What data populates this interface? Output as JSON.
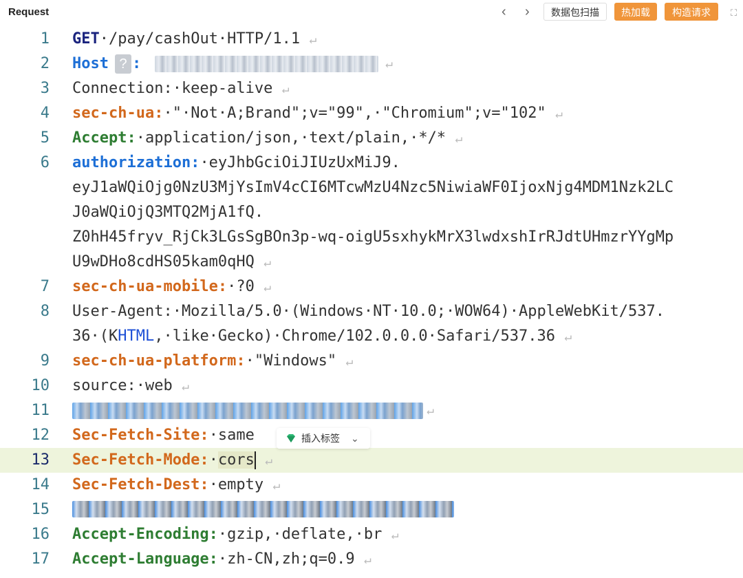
{
  "header": {
    "title": "Request",
    "nav_prev": "‹",
    "nav_next": "›",
    "btn_scan": "数据包扫描",
    "btn_hot": "热加载",
    "btn_build": "构造请求",
    "expand_glyph": "⛶"
  },
  "colors": {
    "accent_orange": "#f0953a",
    "key_blue": "#1d6fd6",
    "key_orange": "#d2681c",
    "key_green": "#2e7d32",
    "highlight_line": "#eef4dc"
  },
  "lines": [
    {
      "n": "1",
      "verb": "GET",
      "rest": "·/pay/cashOut·HTTP/1.1"
    },
    {
      "n": "2",
      "key": "Host",
      "sep": ":"
    },
    {
      "n": "3",
      "text": "Connection:·keep-alive"
    },
    {
      "n": "4",
      "key": "sec-ch-ua:",
      "value": "·\"·Not·A;Brand\";v=\"99\",·\"Chromium\";v=\"102\""
    },
    {
      "n": "5",
      "key": "Accept:",
      "value": "·application/json,·text/plain,·*/*"
    },
    {
      "n": "6",
      "key": "authorization:",
      "value": "·eyJhbGciOiJIUzUxMiJ9.",
      "wrap": [
        "eyJ1aWQiOjg0NzU3MjYsImV4cCI6MTcwMzU4Nzc5NiwiaWF0IjoxNjg4MDM1Nzk2LC",
        "J0aWQiOjQ3MTQ2MjA1fQ.",
        "Z0hH45fryv_RjCk3LGsSgBOn3p-wq-oigU5sxhykMrX3lwdxshIrRJdtUHmzrYYgMp",
        "U9wDHo8cdHS05kam0qHQ"
      ]
    },
    {
      "n": "7",
      "key": "sec-ch-ua-mobile:",
      "value": "·?0"
    },
    {
      "n": "8",
      "text": "User-Agent:·Mozilla/5.0·(Windows·NT·10.0;·WOW64)·AppleWebKit/537.",
      "wrap_a": "36·(K",
      "wrap_link": "HTML",
      "wrap_b": ",·like·Gecko)·Chrome/102.0.0.0·Safari/537.36"
    },
    {
      "n": "9",
      "key": "sec-ch-ua-platform:",
      "value": "·\"Windows\""
    },
    {
      "n": "10",
      "text": "source:·web"
    },
    {
      "n": "11"
    },
    {
      "n": "12",
      "key": "Sec-Fetch-Site:",
      "value": "·same"
    },
    {
      "n": "13",
      "key": "Sec-Fetch-Mode:",
      "value": "·",
      "sel": "cors"
    },
    {
      "n": "14",
      "key": "Sec-Fetch-Dest:",
      "value": "·empty"
    },
    {
      "n": "15"
    },
    {
      "n": "16",
      "key": "Accept-Encoding:",
      "value": "·gzip,·deflate,·br"
    },
    {
      "n": "17",
      "key": "Accept-Language:",
      "value": "·zh-CN,zh;q=0.9"
    }
  ],
  "return_glyph": "↵",
  "host_badge": "?",
  "popup": {
    "label": "插入标签",
    "chevron": "⌄"
  }
}
